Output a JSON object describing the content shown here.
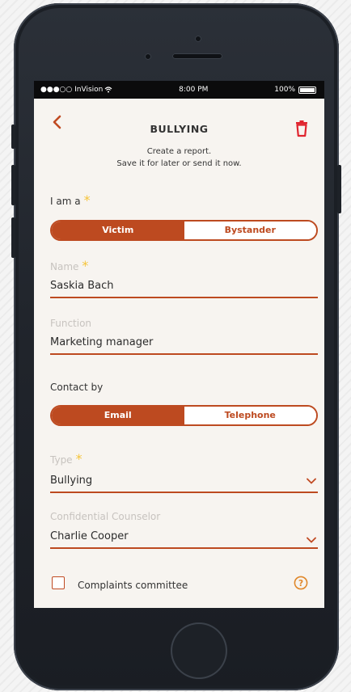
{
  "status_bar": {
    "carrier": "●●●○○ InVision",
    "time": "8:00 PM",
    "battery": "100%",
    "battery_level": 1.0
  },
  "header": {
    "title": "BULLYING",
    "back_icon": "chevron-left-icon",
    "trash_icon": "trash-icon"
  },
  "intro": {
    "line1": "Create a report.",
    "line2": "Save it for later or send it now."
  },
  "role": {
    "label": "I am a",
    "required": "*",
    "options": [
      "Victim",
      "Bystander"
    ],
    "selected": "Victim"
  },
  "name": {
    "label": "Name",
    "required": "*",
    "value": "Saskia Bach"
  },
  "function": {
    "label": "Function",
    "value": "Marketing manager"
  },
  "contact": {
    "label": "Contact by",
    "options": [
      "Email",
      "Telephone"
    ],
    "selected": "Email"
  },
  "type": {
    "label": "Type",
    "required": "*",
    "value": "Bullying"
  },
  "counselor": {
    "label": "Confidential Counselor",
    "value": "Charlie Cooper"
  },
  "complaints": {
    "label": "Complaints committee",
    "checked": false,
    "help": "?"
  },
  "colors": {
    "accent": "#bd4a20",
    "required_star": "#f5c43a",
    "screen_bg": "#f7f4f0"
  }
}
